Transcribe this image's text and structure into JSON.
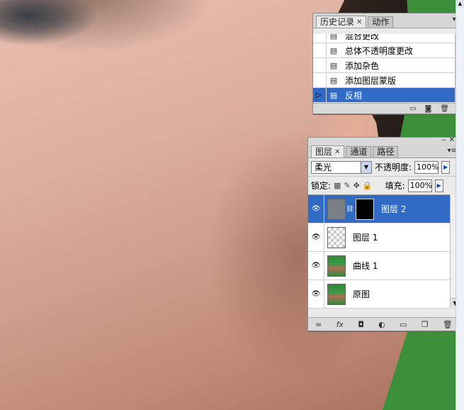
{
  "history_panel": {
    "tabs": [
      {
        "label": "历史记录",
        "active": true
      },
      {
        "label": "动作",
        "active": false
      }
    ],
    "items": [
      {
        "label": "混合更改",
        "selected": false
      },
      {
        "label": "总体不透明度更改",
        "selected": false
      },
      {
        "label": "添加杂色",
        "selected": false
      },
      {
        "label": "添加图层蒙版",
        "selected": false
      },
      {
        "label": "反相",
        "selected": true
      }
    ]
  },
  "layers_panel": {
    "tabs": [
      {
        "label": "图层",
        "active": true
      },
      {
        "label": "通道",
        "active": false
      },
      {
        "label": "路径",
        "active": false
      }
    ],
    "blend_mode": "柔光",
    "opacity_label": "不透明度:",
    "opacity_value": "100%",
    "lock_label": "锁定:",
    "fill_label": "填充:",
    "fill_value": "100%",
    "layers": [
      {
        "name": "图层 2",
        "selected": true,
        "visible": true
      },
      {
        "name": "图层 1",
        "selected": false,
        "visible": true
      },
      {
        "name": "曲线 1",
        "selected": false,
        "visible": true
      },
      {
        "name": "原图",
        "selected": false,
        "visible": true
      }
    ],
    "footer_icons": [
      "link-icon",
      "fx-icon",
      "mask-icon",
      "adjustment-icon",
      "folder-icon",
      "new-layer-icon",
      "trash-icon"
    ]
  }
}
